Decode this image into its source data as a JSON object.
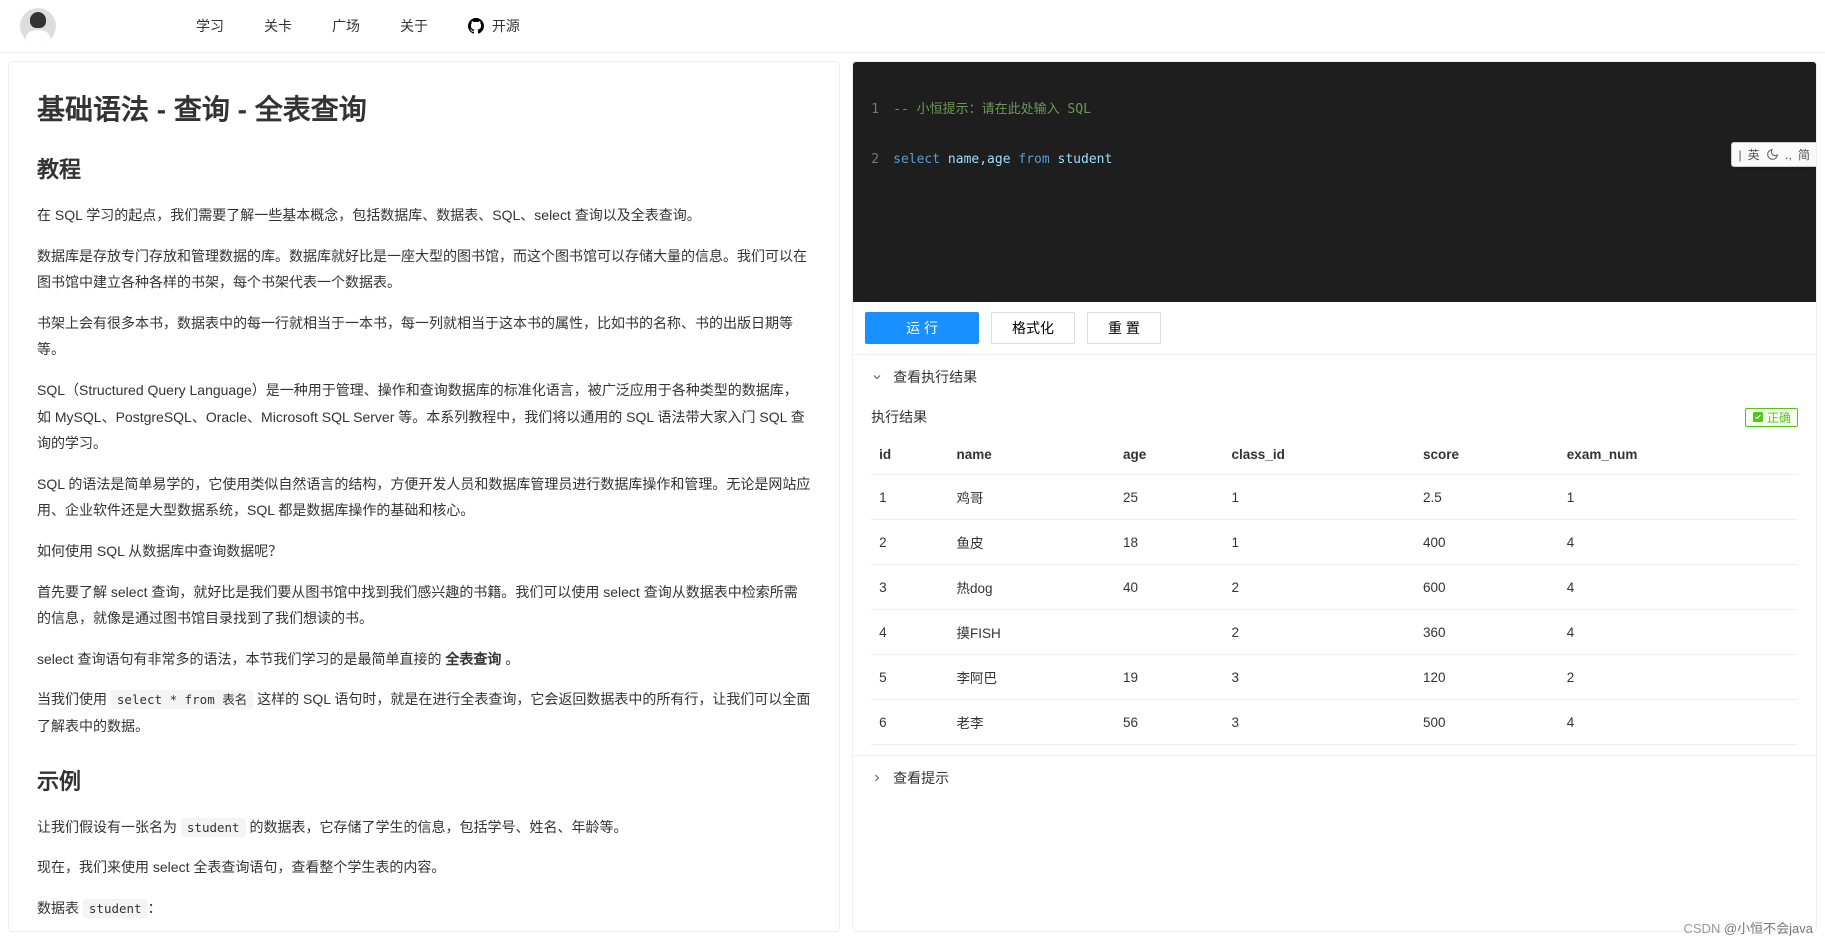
{
  "nav": {
    "items": [
      "学习",
      "关卡",
      "广场",
      "关于"
    ],
    "github": "开源"
  },
  "ime": {
    "a": "|",
    "b": "英",
    "c": "․,",
    "d": "简"
  },
  "article": {
    "title": "基础语法 - 查询 - 全表查询",
    "h2_tutorial": "教程",
    "p1": "在 SQL 学习的起点，我们需要了解一些基本概念，包括数据库、数据表、SQL、select 查询以及全表查询。",
    "p2": "数据库是存放专门存放和管理数据的库。数据库就好比是一座大型的图书馆，而这个图书馆可以存储大量的信息。我们可以在图书馆中建立各种各样的书架，每个书架代表一个数据表。",
    "p3": "书架上会有很多本书，数据表中的每一行就相当于一本书，每一列就相当于这本书的属性，比如书的名称、书的出版日期等等。",
    "p4": "SQL（Structured Query Language）是一种用于管理、操作和查询数据库的标准化语言，被广泛应用于各种类型的数据库，如 MySQL、PostgreSQL、Oracle、Microsoft SQL Server 等。本系列教程中，我们将以通用的 SQL 语法带大家入门 SQL 查询的学习。",
    "p5": "SQL 的语法是简单易学的，它使用类似自然语言的结构，方便开发人员和数据库管理员进行数据库操作和管理。无论是网站应用、企业软件还是大型数据系统，SQL 都是数据库操作的基础和核心。",
    "p6": "如何使用 SQL 从数据库中查询数据呢？",
    "p7": "首先要了解 select 查询，就好比是我们要从图书馆中找到我们感兴趣的书籍。我们可以使用 select 查询从数据表中检索所需的信息，就像是通过图书馆目录找到了我们想读的书。",
    "p8a": "select 查询语句有非常多的语法，本节我们学习的是最简单直接的 ",
    "p8b": "全表查询",
    "p8c": " 。",
    "p9a": "当我们使用 ",
    "p9code": "select * from 表名",
    "p9b": " 这样的 SQL 语句时，就是在进行全表查询，它会返回数据表中的所有行，让我们可以全面了解表中的数据。",
    "h2_example": "示例",
    "p10a": "让我们假设有一张名为 ",
    "p10code": "student",
    "p10b": " 的数据表，它存储了学生的信息，包括学号、姓名、年龄等。",
    "p11": "现在，我们来使用 select 全表查询语句，查看整个学生表的内容。",
    "p12a": "数据表 ",
    "p12code": "student",
    "p12b": "："
  },
  "editor": {
    "line1_comment": "-- 小恒提示：请在此处输入 SQL",
    "line2": {
      "kw1": "select",
      "ids": " name,age ",
      "kw2": "from",
      "tbl": " student"
    }
  },
  "actions": {
    "run": "运 行",
    "format": "格式化",
    "reset": "重 置"
  },
  "result_panel": {
    "toggle": "查看执行结果",
    "title": "执行结果",
    "ok": "正确",
    "hint_toggle": "查看提示",
    "columns": [
      "id",
      "name",
      "age",
      "class_id",
      "score",
      "exam_num"
    ],
    "rows": [
      [
        "1",
        "鸡哥",
        "25",
        "1",
        "2.5",
        "1"
      ],
      [
        "2",
        "鱼皮",
        "18",
        "1",
        "400",
        "4"
      ],
      [
        "3",
        "热dog",
        "40",
        "2",
        "600",
        "4"
      ],
      [
        "4",
        "摸FISH",
        "",
        "2",
        "360",
        "4"
      ],
      [
        "5",
        "李阿巴",
        "19",
        "3",
        "120",
        "2"
      ],
      [
        "6",
        "老李",
        "56",
        "3",
        "500",
        "4"
      ]
    ]
  },
  "watermark": {
    "a": "CSDN ",
    "b": "@小恒不会java"
  }
}
